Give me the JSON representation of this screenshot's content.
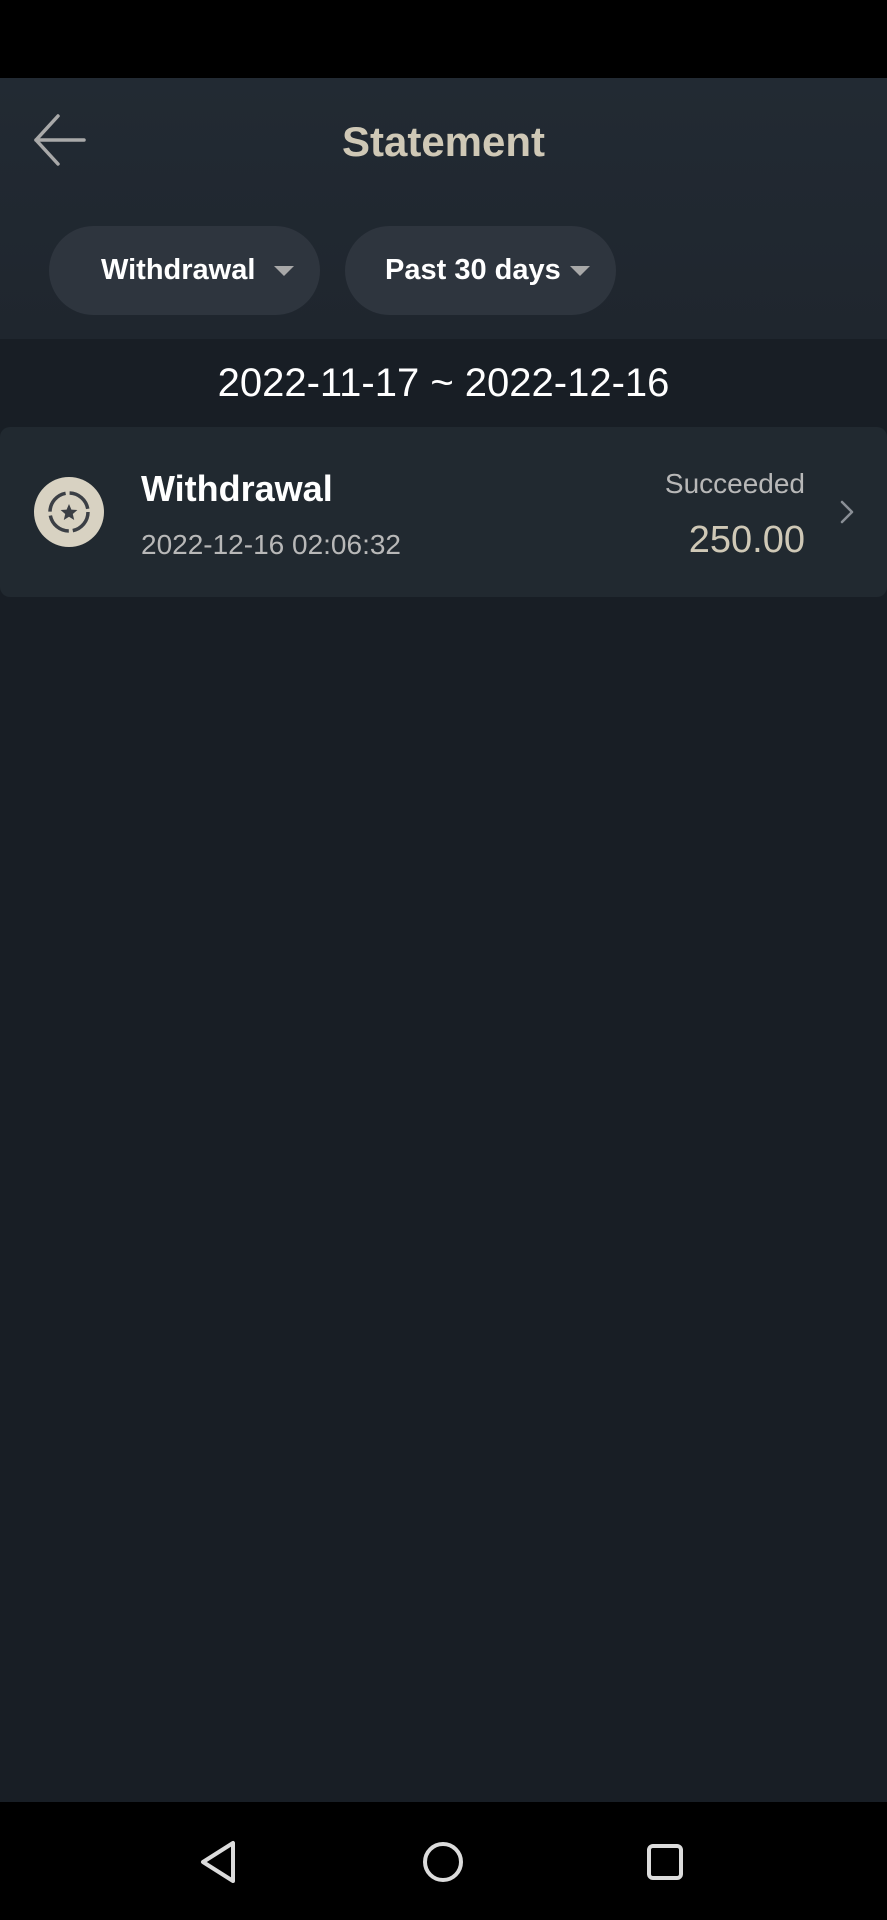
{
  "header": {
    "title": "Statement",
    "back_icon": "arrow-left-icon"
  },
  "filters": {
    "type": {
      "label": "Withdrawal",
      "icon": "caret-down-icon"
    },
    "range": {
      "label": "Past 30 days",
      "icon": "caret-down-icon"
    }
  },
  "date_range": "2022-11-17 ~ 2022-12-16",
  "transactions": [
    {
      "icon": "coin-star-icon",
      "type": "Withdrawal",
      "time": "2022-12-16 02:06:32",
      "status": "Succeeded",
      "amount": "250.00"
    }
  ],
  "nav": {
    "back_icon": "triangle-back-icon",
    "home_icon": "circle-home-icon",
    "recent_icon": "square-recents-icon"
  },
  "colors": {
    "background": "#181e25",
    "header": "#222a33",
    "pill": "#2e353e",
    "accent": "#cfc8b6",
    "row": "#212930"
  }
}
